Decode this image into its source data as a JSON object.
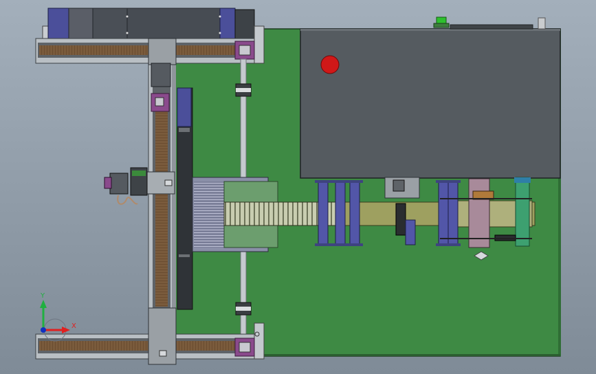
{
  "viewport": {
    "background": "#9aa7b4",
    "gradient_bottom": "#7f8b97"
  },
  "triad": {
    "y_label": "Y",
    "x_label": "X",
    "y_color": "#20b040",
    "x_color": "#e02020",
    "origin_color": "#1030c0"
  },
  "colors": {
    "base_plate": "#3e8a44",
    "dark_panel": "#555b60",
    "rail_frame": "#b9bfc4",
    "belt": "#7a5b3c",
    "carriage": "#9aa0a5",
    "motor_blue": "#4b4f9a",
    "roller_blue": "#5256a8",
    "purple_block": "#8a4a8c",
    "olive_tray": "#9ea060",
    "stop_button": "#d01818"
  }
}
